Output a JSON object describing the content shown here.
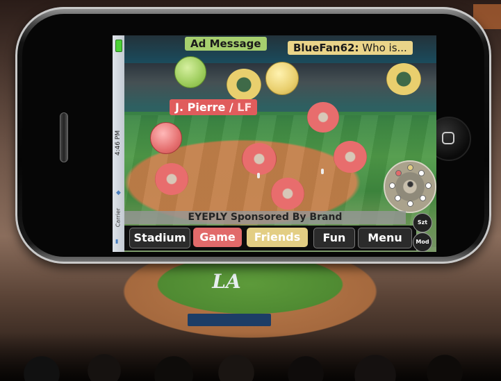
{
  "ad": {
    "label": "Ad Message"
  },
  "chat": {
    "user": "BlueFan62:",
    "message": " Who is..."
  },
  "player": {
    "name": "J. Pierre",
    "separator": " / ",
    "position": "LF"
  },
  "status": {
    "time": "4:46 PM",
    "carrier": "Carrier"
  },
  "sponsor": {
    "text": "EYEPLY Sponsored By Brand"
  },
  "nav": {
    "tabs": [
      "Stadium",
      "Game",
      "Friends",
      "Fun",
      "Menu"
    ]
  },
  "side_buttons": {
    "szt": "Szt",
    "mod": "Mod"
  },
  "logo": {
    "text": "LA"
  },
  "colors": {
    "game": "#e16a6a",
    "friends": "#e3ce84",
    "ad": "#a6cf6e"
  }
}
